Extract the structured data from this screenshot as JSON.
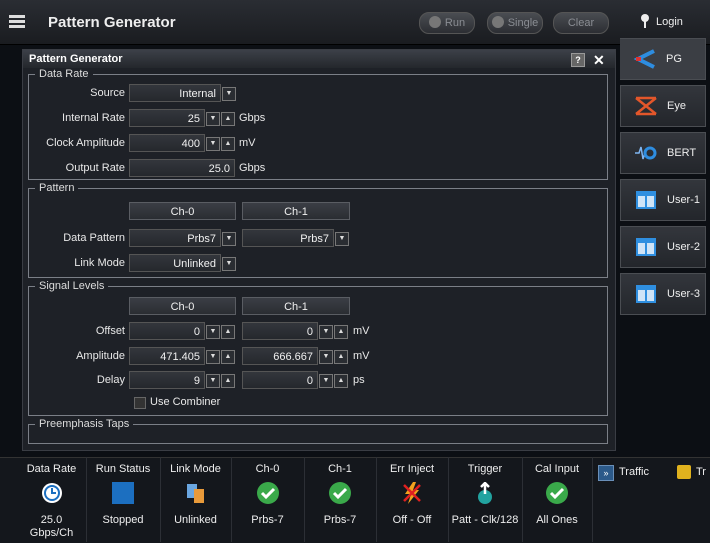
{
  "app": {
    "title": "Pattern Generator",
    "run": "Run",
    "single": "Single",
    "clear": "Clear",
    "login": "Login"
  },
  "panel": {
    "title": "Pattern Generator",
    "help": "?"
  },
  "datarate": {
    "legend": "Data Rate",
    "source_label": "Source",
    "source_value": "Internal",
    "irate_label": "Internal Rate",
    "irate_value": "25",
    "irate_unit": "Gbps",
    "clock_label": "Clock Amplitude",
    "clock_value": "400",
    "clock_unit": "mV",
    "out_label": "Output Rate",
    "out_value": "25.0",
    "out_unit": "Gbps"
  },
  "pattern": {
    "legend": "Pattern",
    "ch0": "Ch-0",
    "ch1": "Ch-1",
    "dp_label": "Data Pattern",
    "dp0": "Prbs7",
    "dp1": "Prbs7",
    "lm_label": "Link Mode",
    "lm_value": "Unlinked"
  },
  "signal": {
    "legend": "Signal Levels",
    "ch0": "Ch-0",
    "ch1": "Ch-1",
    "offset_label": "Offset",
    "offset0": "0",
    "offset1": "0",
    "offset_unit": "mV",
    "amp_label": "Amplitude",
    "amp0": "471.405",
    "amp1": "666.667",
    "amp_unit": "mV",
    "delay_label": "Delay",
    "delay0": "9",
    "delay1": "0",
    "delay_unit": "ps",
    "combiner": "Use Combiner"
  },
  "preemph": {
    "legend": "Preemphasis Taps"
  },
  "tabs": [
    {
      "label": "PG"
    },
    {
      "label": "Eye"
    },
    {
      "label": "BERT"
    },
    {
      "label": "User-1"
    },
    {
      "label": "User-2"
    },
    {
      "label": "User-3"
    }
  ],
  "status": [
    {
      "title": "Data Rate",
      "value": "25.0",
      "value2": "Gbps/Ch"
    },
    {
      "title": "Run Status",
      "value": "Stopped"
    },
    {
      "title": "Link Mode",
      "value": "Unlinked"
    },
    {
      "title": "Ch-0",
      "value": "Prbs-7"
    },
    {
      "title": "Ch-1",
      "value": "Prbs-7"
    },
    {
      "title": "Err Inject",
      "value": "Off - Off"
    },
    {
      "title": "Trigger",
      "value": "Patt - Clk/128"
    },
    {
      "title": "Cal Input",
      "value": "All Ones"
    }
  ],
  "traffic": {
    "label": "Traffic",
    "label2": "Tr"
  }
}
